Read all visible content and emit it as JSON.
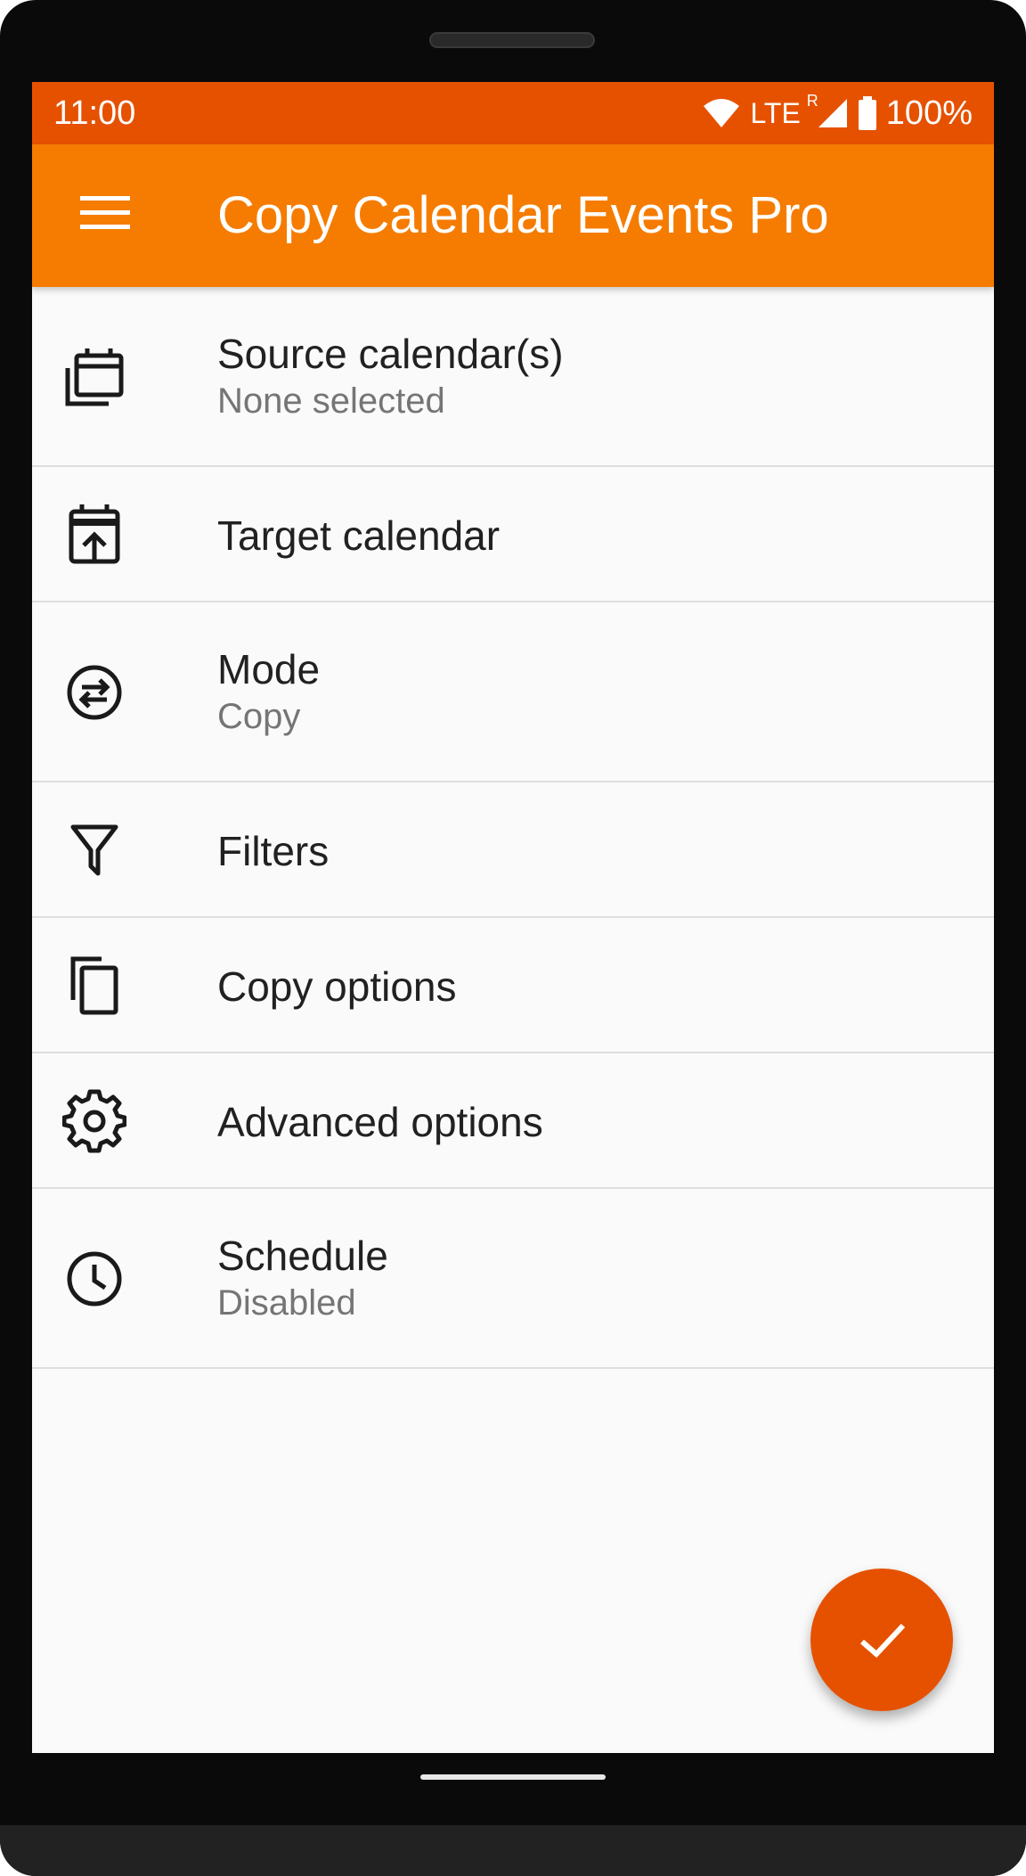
{
  "status_bar": {
    "time": "11:00",
    "network": "LTE",
    "roaming": "R",
    "battery": "100%",
    "color": "#e65100"
  },
  "app_bar": {
    "title": "Copy Calendar Events Pro",
    "menu_icon": "hamburger-menu-icon",
    "color": "#f57c00"
  },
  "items": [
    {
      "icon": "calendar-multiple-icon",
      "label": "Source calendar(s)",
      "subtitle": "None selected"
    },
    {
      "icon": "calendar-export-icon",
      "label": "Target calendar"
    },
    {
      "icon": "swap-circle-icon",
      "label": "Mode",
      "subtitle": "Copy"
    },
    {
      "icon": "filter-icon",
      "label": "Filters"
    },
    {
      "icon": "copy-icon",
      "label": "Copy options"
    },
    {
      "icon": "gear-icon",
      "label": "Advanced options"
    },
    {
      "icon": "clock-icon",
      "label": "Schedule",
      "subtitle": "Disabled"
    }
  ],
  "fab": {
    "icon": "check-icon",
    "color": "#e65100"
  }
}
